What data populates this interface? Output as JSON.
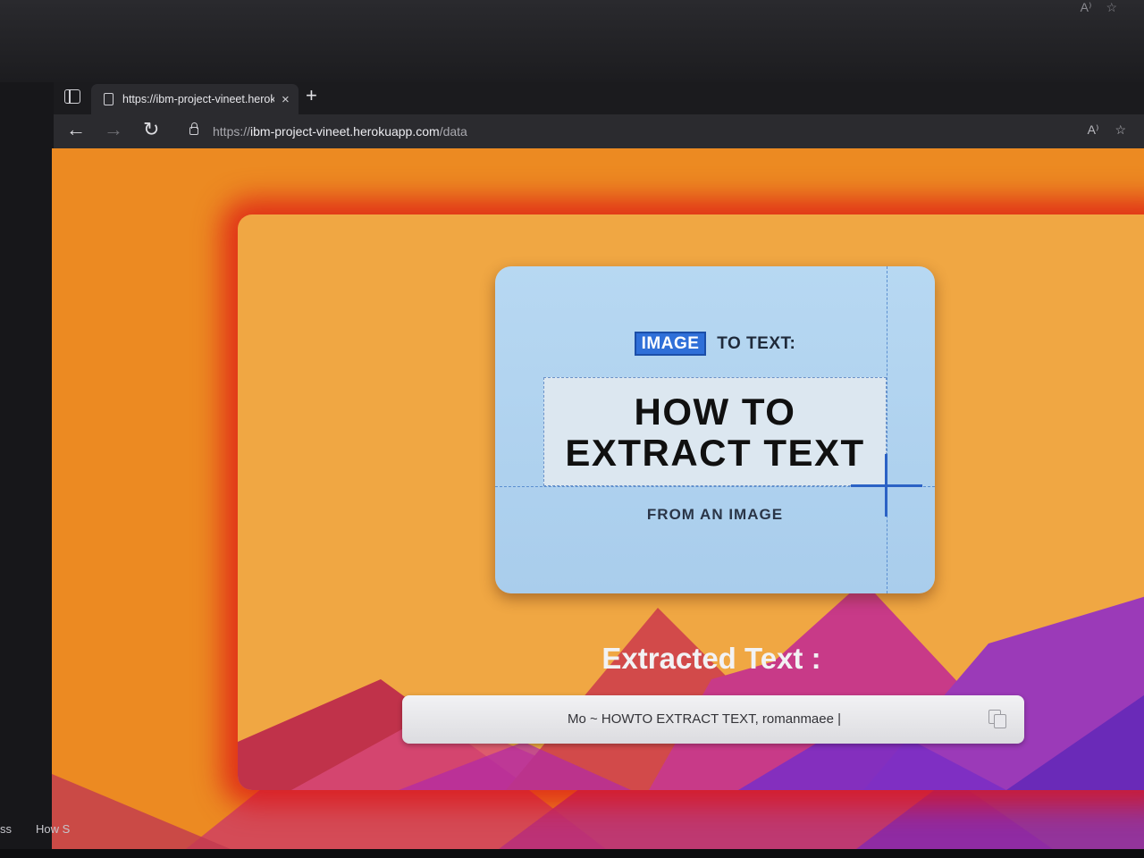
{
  "browser": {
    "tab_title": "https://ibm-project-vineet.herok",
    "new_tab_glyph": "+",
    "close_glyph": "×",
    "url_scheme": "https://",
    "url_host": "ibm-project-vineet.herokuapp.com",
    "url_path": "/data",
    "back_glyph": "←",
    "forward_glyph": "→",
    "reload_glyph": "↻",
    "read_aloud_glyph": "A⁾",
    "favorite_glyph": "☆"
  },
  "page": {
    "image": {
      "badge": "IMAGE",
      "line1_rest": "TO TEXT:",
      "headline_1": "HOW TO",
      "headline_2": "EXTRACT TEXT",
      "subline": "FROM AN IMAGE"
    },
    "heading": "Extracted Text :",
    "result": "Mo ~ HOWTO EXTRACT TEXT, romanmaee |"
  },
  "taskbar": {
    "item1": "ss",
    "item2": "How S"
  },
  "colors": {
    "page_orange": "#ec8a22",
    "card_orange": "#f0a743",
    "glow_red": "#dc1414",
    "image_blue": "#b7d8f2",
    "badge_blue": "#2f6fd8"
  }
}
